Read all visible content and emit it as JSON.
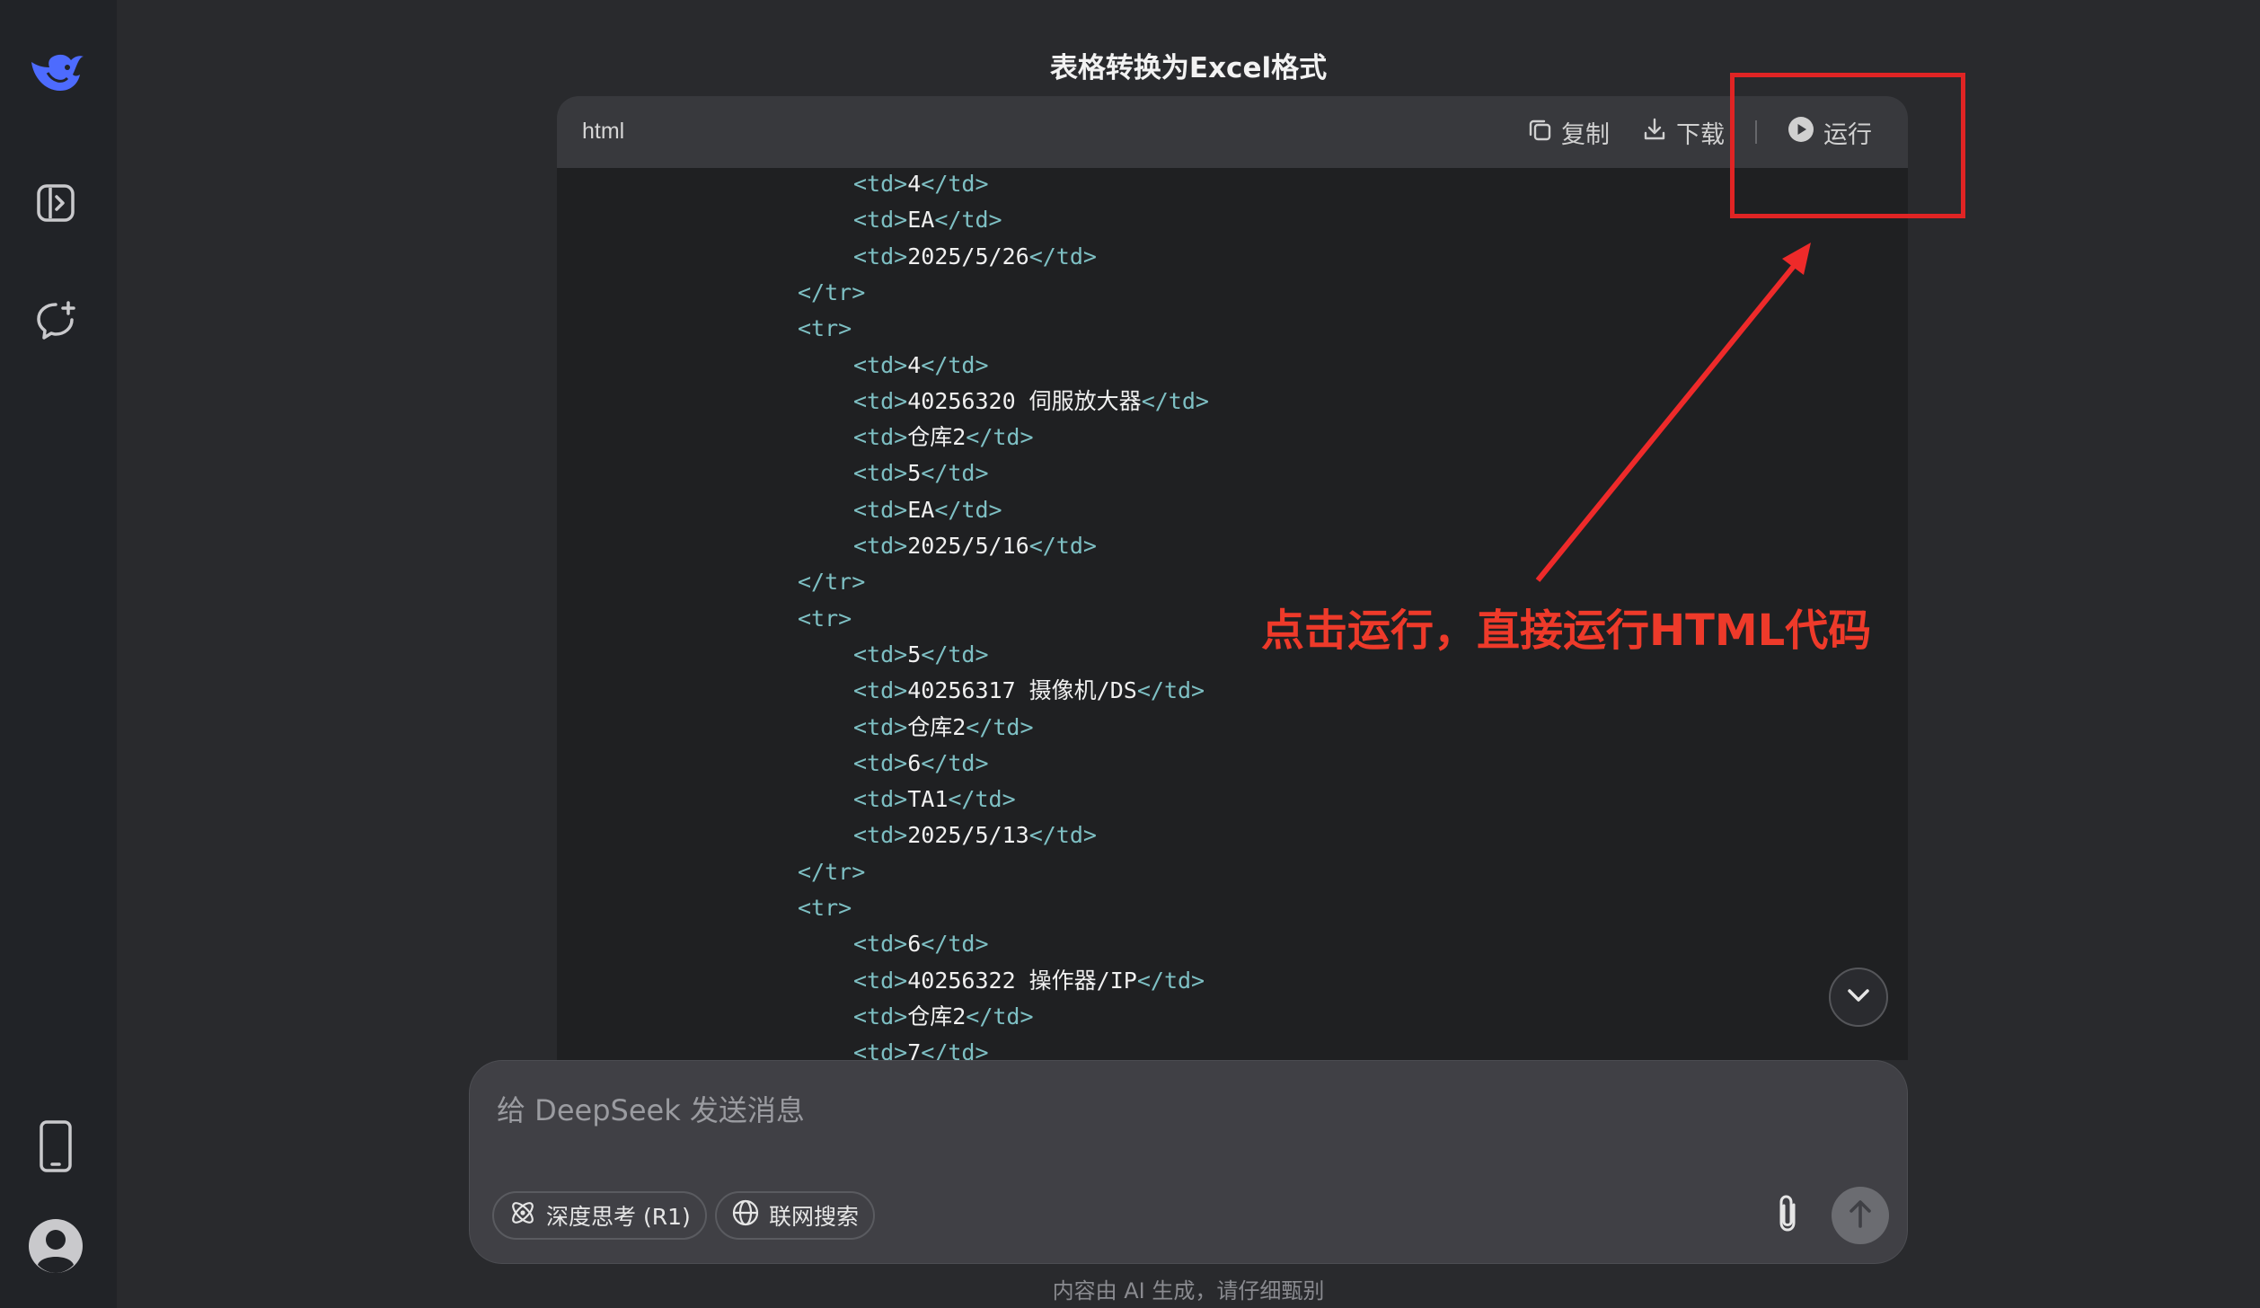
{
  "window": {
    "title": "表格转换为Excel格式"
  },
  "sidebar": {
    "icons": [
      "deepseek-logo",
      "sidebar-toggle-icon",
      "new-chat-icon",
      "mobile-app-icon",
      "user-avatar-icon"
    ]
  },
  "code_block": {
    "language": "html",
    "copy_label": "复制",
    "download_label": "下载",
    "run_label": "运行",
    "lines": [
      {
        "indent": 2,
        "open": "<td>",
        "text": "4",
        "close": "</td>"
      },
      {
        "indent": 2,
        "open": "<td>",
        "text": "EA",
        "close": "</td>"
      },
      {
        "indent": 2,
        "open": "<td>",
        "text": "2025/5/26",
        "close": "</td>"
      },
      {
        "indent": 1,
        "open": "</tr>",
        "text": "",
        "close": ""
      },
      {
        "indent": 1,
        "open": "<tr>",
        "text": "",
        "close": ""
      },
      {
        "indent": 2,
        "open": "<td>",
        "text": "4",
        "close": "</td>"
      },
      {
        "indent": 2,
        "open": "<td>",
        "text": "40256320 伺服放大器",
        "close": "</td>"
      },
      {
        "indent": 2,
        "open": "<td>",
        "text": "仓库2",
        "close": "</td>"
      },
      {
        "indent": 2,
        "open": "<td>",
        "text": "5",
        "close": "</td>"
      },
      {
        "indent": 2,
        "open": "<td>",
        "text": "EA",
        "close": "</td>"
      },
      {
        "indent": 2,
        "open": "<td>",
        "text": "2025/5/16",
        "close": "</td>"
      },
      {
        "indent": 1,
        "open": "</tr>",
        "text": "",
        "close": ""
      },
      {
        "indent": 1,
        "open": "<tr>",
        "text": "",
        "close": ""
      },
      {
        "indent": 2,
        "open": "<td>",
        "text": "5",
        "close": "</td>"
      },
      {
        "indent": 2,
        "open": "<td>",
        "text": "40256317 摄像机/DS",
        "close": "</td>"
      },
      {
        "indent": 2,
        "open": "<td>",
        "text": "仓库2",
        "close": "</td>"
      },
      {
        "indent": 2,
        "open": "<td>",
        "text": "6",
        "close": "</td>"
      },
      {
        "indent": 2,
        "open": "<td>",
        "text": "TA1",
        "close": "</td>"
      },
      {
        "indent": 2,
        "open": "<td>",
        "text": "2025/5/13",
        "close": "</td>"
      },
      {
        "indent": 1,
        "open": "</tr>",
        "text": "",
        "close": ""
      },
      {
        "indent": 1,
        "open": "<tr>",
        "text": "",
        "close": ""
      },
      {
        "indent": 2,
        "open": "<td>",
        "text": "6",
        "close": "</td>"
      },
      {
        "indent": 2,
        "open": "<td>",
        "text": "40256322 操作器/IP",
        "close": "</td>"
      },
      {
        "indent": 2,
        "open": "<td>",
        "text": "仓库2",
        "close": "</td>"
      },
      {
        "indent": 2,
        "open": "<td>",
        "text": "7",
        "close": "</td>"
      }
    ]
  },
  "annotation": {
    "text": "点击运行，直接运行HTML代码",
    "color": "#e02424"
  },
  "composer": {
    "placeholder": "给 DeepSeek 发送消息",
    "deep_think_label": "深度思考 (R1)",
    "web_search_label": "联网搜索"
  },
  "footer": {
    "note": "内容由 AI 生成，请仔细甄别"
  }
}
